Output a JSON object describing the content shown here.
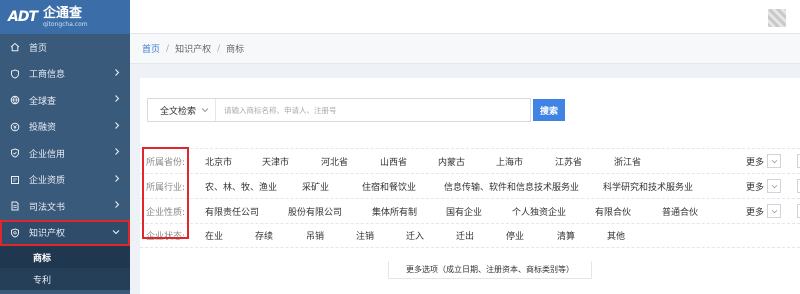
{
  "brand": {
    "logo": "ADT",
    "title": "企通查",
    "subtitle": "qitongcha.com"
  },
  "sidebar": {
    "items": [
      {
        "label": "首页",
        "icon": "home-icon",
        "has_chevron": false
      },
      {
        "label": "工商信息",
        "icon": "shield-icon",
        "has_chevron": true
      },
      {
        "label": "全球查",
        "icon": "globe-icon",
        "has_chevron": true
      },
      {
        "label": "投融资",
        "icon": "coin-icon",
        "has_chevron": true
      },
      {
        "label": "企业信用",
        "icon": "credit-icon",
        "has_chevron": true
      },
      {
        "label": "企业资质",
        "icon": "certificate-icon",
        "has_chevron": true
      },
      {
        "label": "司法文书",
        "icon": "document-icon",
        "has_chevron": true
      },
      {
        "label": "知识产权",
        "icon": "ip-icon",
        "has_chevron": true,
        "active": true
      }
    ],
    "sub_items": [
      {
        "label": "商标",
        "current": true
      },
      {
        "label": "专利",
        "current": false
      }
    ]
  },
  "breadcrumb": {
    "home": "首页",
    "sep": "/",
    "level2": "知识产权",
    "level3": "商标"
  },
  "search": {
    "type_label": "全文检索",
    "placeholder": "请输入商标名称、申请人、注册号",
    "button_label": "搜索"
  },
  "filters": [
    {
      "label": "所属省份:",
      "options": [
        "北京市",
        "天津市",
        "河北省",
        "山西省",
        "内蒙古",
        "上海市",
        "江苏省",
        "浙江省"
      ]
    },
    {
      "label": "所属行业:",
      "options": [
        "农、林、牧、渔业",
        "采矿业",
        "住宿和餐饮业",
        "信息传输、软件和信息技术服务业",
        "科学研究和技术服务业"
      ]
    },
    {
      "label": "企业性质:",
      "options": [
        "有限责任公司",
        "股份有限公司",
        "集体所有制",
        "国有企业",
        "个人独资企业",
        "有限合伙",
        "普通合伙"
      ]
    },
    {
      "label": "企业状态:",
      "options": [
        "在业",
        "存续",
        "吊销",
        "注销",
        "迁入",
        "迁出",
        "停业",
        "清算",
        "其他"
      ]
    }
  ],
  "more_label": "更多",
  "more_options_label": "更多选项（成立日期、注册资本、商标类别等）",
  "colors": {
    "sidebar": "#3a5a7c",
    "brand": "#3b6ea8",
    "accent": "#3f84e5",
    "highlight": "#e0262b"
  }
}
